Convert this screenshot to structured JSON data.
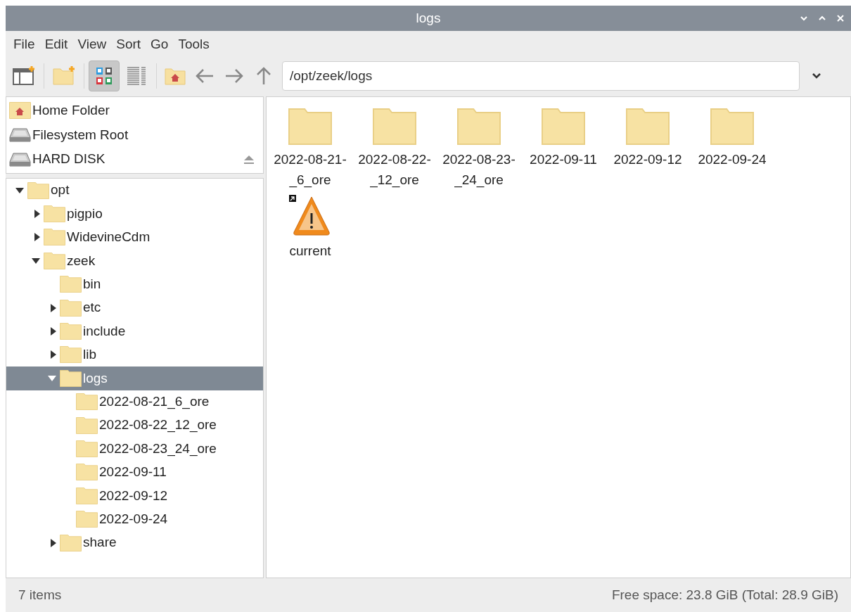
{
  "window": {
    "title": "logs"
  },
  "menu": [
    "File",
    "Edit",
    "View",
    "Sort",
    "Go",
    "Tools"
  ],
  "toolbar": {
    "views": [
      {
        "kind": "icons",
        "selected": true
      },
      {
        "kind": "list",
        "selected": false
      }
    ],
    "path": "/opt/zeek/logs"
  },
  "places": [
    {
      "kind": "home",
      "label": "Home Folder"
    },
    {
      "kind": "disk",
      "label": "Filesystem Root"
    },
    {
      "kind": "disk",
      "label": "HARD DISK",
      "ejectable": true
    }
  ],
  "tree": [
    {
      "label": "opt",
      "expanded": true,
      "selected": false,
      "children": [
        {
          "label": "pigpio",
          "expanded": false,
          "selected": false
        },
        {
          "label": "WidevineCdm",
          "expanded": false,
          "selected": false
        },
        {
          "label": "zeek",
          "expanded": true,
          "selected": false,
          "children": [
            {
              "label": "bin",
              "selected": false
            },
            {
              "label": "etc",
              "expanded": false,
              "selected": false
            },
            {
              "label": "include",
              "expanded": false,
              "selected": false
            },
            {
              "label": "lib",
              "expanded": false,
              "selected": false
            },
            {
              "label": "logs",
              "expanded": true,
              "selected": true,
              "children": [
                {
                  "label": "2022-08-21_6_ore",
                  "selected": false
                },
                {
                  "label": "2022-08-22_12_ore",
                  "selected": false
                },
                {
                  "label": "2022-08-23_24_ore",
                  "selected": false
                },
                {
                  "label": "2022-09-11",
                  "selected": false
                },
                {
                  "label": "2022-09-12",
                  "selected": false
                },
                {
                  "label": "2022-09-24",
                  "selected": false
                }
              ]
            },
            {
              "label": "share",
              "expanded": false,
              "selected": false
            }
          ]
        }
      ]
    }
  ],
  "files": [
    {
      "kind": "folder",
      "label_lines": [
        "2022-08-21-",
        "_6_ore"
      ]
    },
    {
      "kind": "folder",
      "label_lines": [
        "2022-08-22-",
        "_12_ore"
      ]
    },
    {
      "kind": "folder",
      "label_lines": [
        "2022-08-23-",
        "_24_ore"
      ]
    },
    {
      "kind": "folder",
      "label_lines": [
        "2022-09-11"
      ]
    },
    {
      "kind": "folder",
      "label_lines": [
        "2022-09-12"
      ]
    },
    {
      "kind": "folder",
      "label_lines": [
        "2022-09-24"
      ]
    },
    {
      "kind": "broken_link",
      "label_lines": [
        "current"
      ]
    }
  ],
  "status_bar": {
    "count": "7 items",
    "space": "Free space: 23.8 GiB (Total: 28.9 GiB)"
  }
}
